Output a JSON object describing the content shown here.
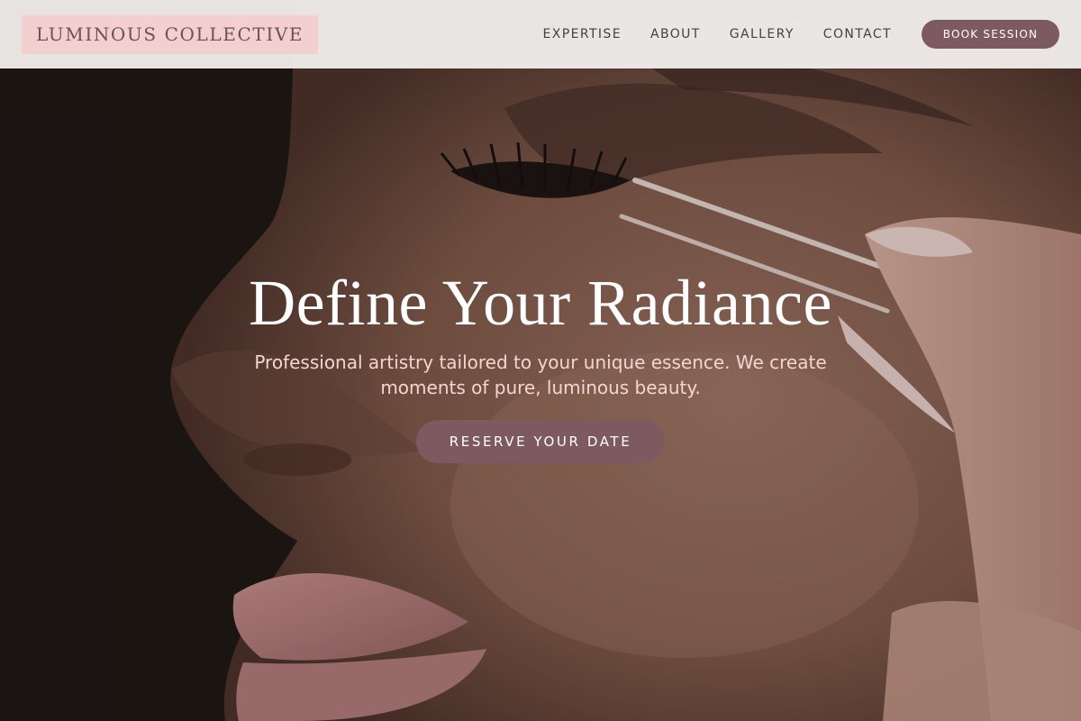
{
  "brand": {
    "name": "LUMINOUS COLLECTIVE"
  },
  "nav": {
    "items": [
      "EXPERTISE",
      "ABOUT",
      "GALLERY",
      "CONTACT"
    ],
    "cta_label": "BOOK SESSION"
  },
  "hero": {
    "title": "Define Your Radiance",
    "subtitle": "Professional artistry tailored to your unique essence. We create moments of pure, luminous beauty.",
    "cta_label": "RESERVE YOUR DATE",
    "image_subject": "close-up of a face with false eyelashes being applied with tweezers"
  },
  "colors": {
    "accent": "#7d5a60",
    "logo_bg": "#f3cfcf",
    "header_bg": "#f5f3f1",
    "subtitle_text": "#f3d6d2"
  }
}
